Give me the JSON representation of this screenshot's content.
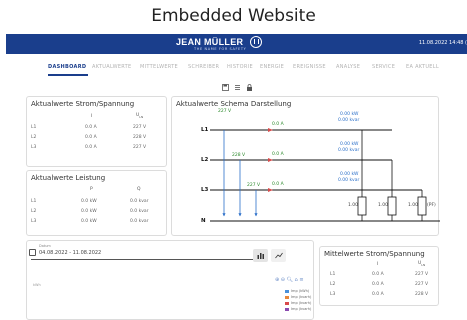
{
  "caption": "Embedded Website",
  "header": {
    "brand": "JEAN MÜLLER",
    "brand_sub": "THE NAME FOR SAFETY",
    "datetime": "11.08.2022 14:48 ("
  },
  "nav": {
    "items": [
      "DASHBOARD",
      "AKTUALWERTE",
      "MITTELWERTE",
      "SCHREIBER",
      "HISTORIE",
      "ENERGIE",
      "EREIGNISSE",
      "ANALYSE",
      "SERVICE",
      "EA AKTUELL"
    ],
    "active": "DASHBOARD"
  },
  "toolbar": {
    "icons": [
      "save-icon",
      "list-icon",
      "lock-icon"
    ]
  },
  "strom": {
    "title": "Aktualwerte Strom/Spannung",
    "col_i": "I",
    "col_u": "U",
    "col_u_sub": "LN",
    "rows": [
      {
        "label": "L1",
        "i": "0.0 A",
        "u": "227 V"
      },
      {
        "label": "L2",
        "i": "0.0 A",
        "u": "228 V"
      },
      {
        "label": "L3",
        "i": "0.0 A",
        "u": "227 V"
      }
    ]
  },
  "leistung": {
    "title": "Aktualwerte Leistung",
    "col_p": "P",
    "col_q": "Q",
    "rows": [
      {
        "label": "L1",
        "p": "0.0 kW",
        "q": "0.0 kvar"
      },
      {
        "label": "L2",
        "p": "0.0 kW",
        "q": "0.0 kvar"
      },
      {
        "label": "L3",
        "p": "0.0 kW",
        "q": "0.0 kvar"
      }
    ]
  },
  "schema": {
    "title": "Aktualwerte Schema Darstellung",
    "phases": [
      {
        "label": "L1",
        "voltage": "227 V",
        "current": "0.0 A",
        "kw": "0.00 kW",
        "kvar": "0.00 kvar",
        "pf": "1.00"
      },
      {
        "label": "L2",
        "voltage": "228 V",
        "current": "0.0 A",
        "kw": "0.00 kW",
        "kvar": "0.00 kvar",
        "pf": "1.00"
      },
      {
        "label": "L3",
        "voltage": "227 V",
        "current": "0.0 A",
        "kw": "0.00 kW",
        "kvar": "0.00 kvar",
        "pf": "1.00"
      }
    ],
    "neutral": "N",
    "pf_label": "(PF)"
  },
  "history": {
    "date_label": "Datum",
    "date_range": "04.08.2022 - 11.08.2022",
    "y_label": "kWh",
    "legend": [
      {
        "label": "Imp (kWh)",
        "color": "#4a90d9"
      },
      {
        "label": "Imp (kvarh)",
        "color": "#e8873a"
      },
      {
        "label": "Imp (kvarh)",
        "color": "#d94a4a"
      },
      {
        "label": "Imp (kvarh)",
        "color": "#8a4ab0"
      }
    ]
  },
  "mittel": {
    "title": "Mittelwerte Strom/Spannung",
    "col_i": "I",
    "col_u": "U",
    "col_u_sub": "LN",
    "rows": [
      {
        "label": "L1",
        "i": "0.0 A",
        "u": "227 V"
      },
      {
        "label": "L2",
        "i": "0.0 A",
        "u": "227 V"
      },
      {
        "label": "L3",
        "i": "0.0 A",
        "u": "228 V"
      }
    ]
  }
}
